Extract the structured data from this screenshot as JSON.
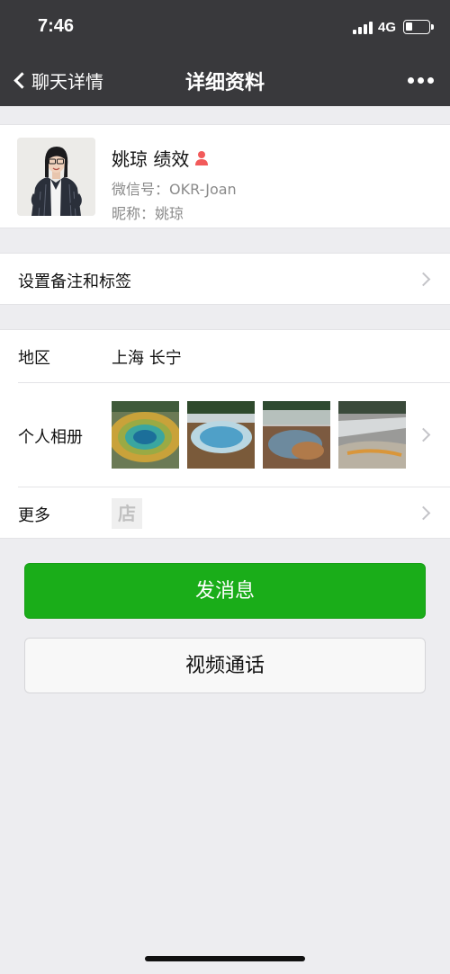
{
  "status_bar": {
    "time": "7:46",
    "network": "4G",
    "battery_percent": 20
  },
  "nav": {
    "back_label": "聊天详情",
    "title": "详细资料",
    "more_icon": "more-dots-icon"
  },
  "profile": {
    "name": "姚琼 绩效",
    "wechat_id_label": "微信号：",
    "wechat_id": "OKR-Joan",
    "nickname_label": "昵称：",
    "nickname": "姚琼",
    "gender_icon": "female-person-icon",
    "gender_color": "#f25a5a"
  },
  "remark_row": {
    "label": "设置备注和标签"
  },
  "region_row": {
    "label": "地区",
    "value": "上海 长宁"
  },
  "album_row": {
    "label": "个人相册",
    "photos": [
      "hot-spring-photo-1",
      "hot-spring-photo-2",
      "hot-spring-photo-3",
      "hot-spring-photo-4"
    ]
  },
  "more_row": {
    "label": "更多",
    "shop_icon_text": "店"
  },
  "actions": {
    "send_message": "发消息",
    "video_call": "视频通话"
  },
  "colors": {
    "nav_bg": "#39393c",
    "primary_green": "#1aad19",
    "page_bg": "#ededf0"
  }
}
